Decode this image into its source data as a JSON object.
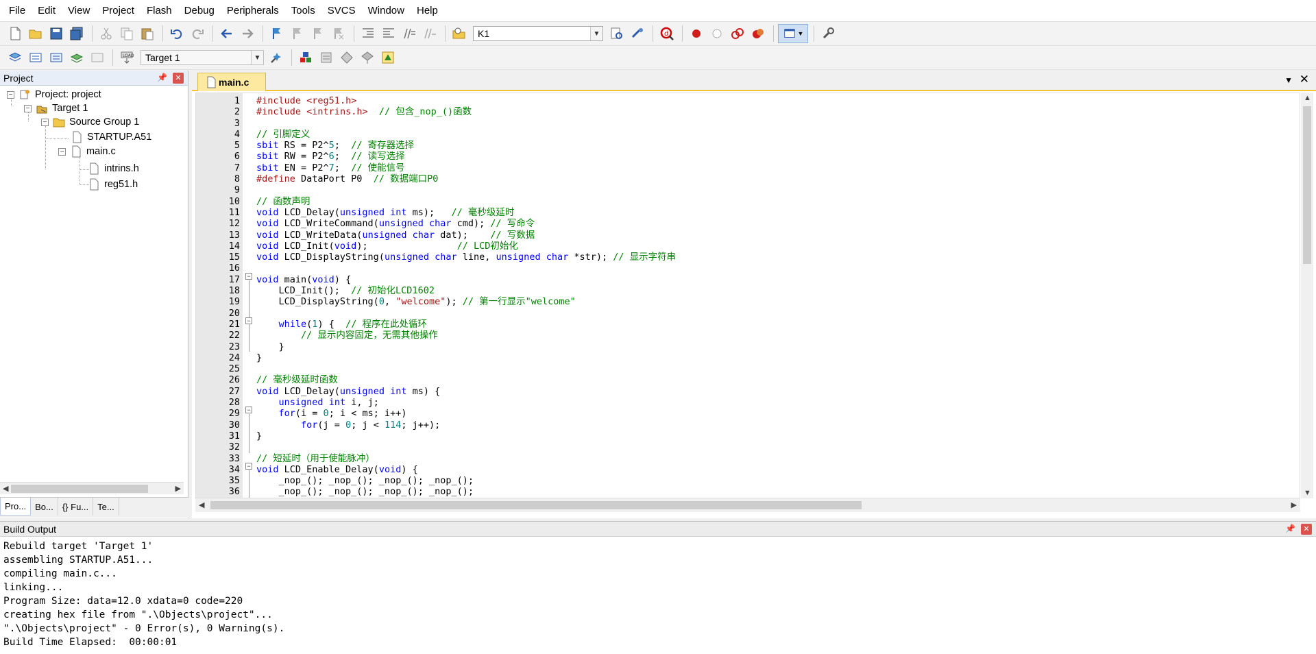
{
  "menu": [
    "File",
    "Edit",
    "View",
    "Project",
    "Flash",
    "Debug",
    "Peripherals",
    "Tools",
    "SVCS",
    "Window",
    "Help"
  ],
  "toolbar1": {
    "find_combo_value": "K1"
  },
  "toolbar2": {
    "target_combo_value": "Target 1"
  },
  "project_panel": {
    "title": "Project",
    "tree": {
      "root": "Project: project",
      "target": "Target 1",
      "group": "Source Group 1",
      "files": [
        "STARTUP.A51",
        "main.c",
        "intrins.h",
        "reg51.h"
      ]
    },
    "tabs": [
      "Pro...",
      "Bo...",
      "{} Fu...",
      "Te..."
    ]
  },
  "editor": {
    "tab_label": "main.c",
    "line_numbers": [
      "1",
      "2",
      "3",
      "4",
      "5",
      "6",
      "7",
      "8",
      "9",
      "10",
      "11",
      "12",
      "13",
      "14",
      "15",
      "16",
      "17",
      "18",
      "19",
      "20",
      "21",
      "22",
      "23",
      "24",
      "25",
      "26",
      "27",
      "28",
      "29",
      "30",
      "31",
      "32",
      "33",
      "34",
      "35",
      "36"
    ],
    "lines": [
      {
        "t": "#include <reg51.h>"
      },
      {
        "t": "#include <intrins.h>  // 包含_nop_()函数"
      },
      {
        "t": ""
      },
      {
        "t": "// 引脚定义"
      },
      {
        "t": "sbit RS = P2^5;  // 寄存器选择"
      },
      {
        "t": "sbit RW = P2^6;  // 读写选择"
      },
      {
        "t": "sbit EN = P2^7;  // 使能信号"
      },
      {
        "t": "#define DataPort P0  // 数据端口P0"
      },
      {
        "t": ""
      },
      {
        "t": "// 函数声明"
      },
      {
        "t": "void LCD_Delay(unsigned int ms);   // 毫秒级延时"
      },
      {
        "t": "void LCD_WriteCommand(unsigned char cmd); // 写命令"
      },
      {
        "t": "void LCD_WriteData(unsigned char dat);    // 写数据"
      },
      {
        "t": "void LCD_Init(void);                // LCD初始化"
      },
      {
        "t": "void LCD_DisplayString(unsigned char line, unsigned char *str); // 显示字符串"
      },
      {
        "t": ""
      },
      {
        "t": "void main(void) {"
      },
      {
        "t": "    LCD_Init();  // 初始化LCD1602"
      },
      {
        "t": "    LCD_DisplayString(0, \"welcome\"); // 第一行显示\"welcome\""
      },
      {
        "t": ""
      },
      {
        "t": "    while(1) {  // 程序在此处循环"
      },
      {
        "t": "        // 显示内容固定，无需其他操作"
      },
      {
        "t": "    }"
      },
      {
        "t": "}"
      },
      {
        "t": ""
      },
      {
        "t": "// 毫秒级延时函数"
      },
      {
        "t": "void LCD_Delay(unsigned int ms) {"
      },
      {
        "t": "    unsigned int i, j;"
      },
      {
        "t": "    for(i = 0; i < ms; i++)"
      },
      {
        "t": "        for(j = 0; j < 114; j++);"
      },
      {
        "t": "}"
      },
      {
        "t": ""
      },
      {
        "t": "// 短延时（用于使能脉冲）"
      },
      {
        "t": "void LCD_Enable_Delay(void) {"
      },
      {
        "t": "    _nop_(); _nop_(); _nop_(); _nop_();"
      },
      {
        "t": "    _nop_(); _nop_(); _nop_(); _nop_();"
      }
    ]
  },
  "build_output": {
    "title": "Build Output",
    "lines": [
      "Rebuild target 'Target 1'",
      "assembling STARTUP.A51...",
      "compiling main.c...",
      "linking...",
      "Program Size: data=12.0 xdata=0 code=220",
      "creating hex file from \".\\Objects\\project\"...",
      "\".\\Objects\\project\" - 0 Error(s), 0 Warning(s).",
      "Build Time Elapsed:  00:00:01"
    ]
  },
  "colors": {
    "keyword": "#0000ff",
    "comment": "#008000",
    "preprocessor": "#a31515",
    "number": "#008080",
    "tab_active": "#fde9a0"
  }
}
